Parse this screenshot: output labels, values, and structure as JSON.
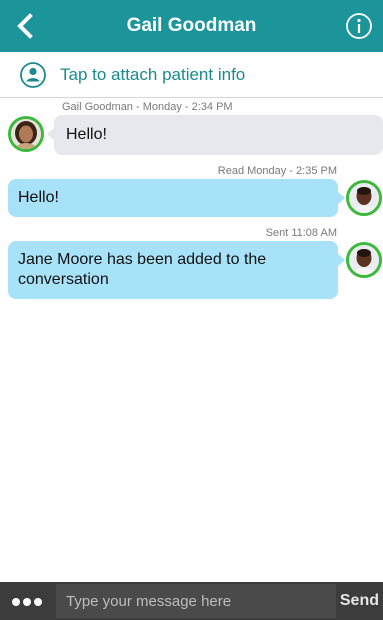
{
  "header": {
    "title": "Gail Goodman",
    "back_icon": "chevron-left-icon",
    "info_icon": "info-circle-icon",
    "color": "#1b949a"
  },
  "attach": {
    "label": "Tap to attach patient info",
    "icon": "user-circle-icon"
  },
  "messages": [
    {
      "direction": "incoming",
      "meta": "Gail Goodman - Monday - 2:34 PM",
      "text": "Hello!",
      "avatar": "female-avatar"
    },
    {
      "direction": "outgoing",
      "meta": "Read  Monday - 2:35 PM",
      "text": "Hello!",
      "avatar": "male-avatar"
    },
    {
      "direction": "outgoing",
      "meta": "Sent  11:08 AM",
      "text": "Jane Moore has been added to the conversation",
      "avatar": "male-avatar"
    }
  ],
  "composer": {
    "placeholder": "Type your message here",
    "send_label": "Send",
    "more_icon": "more-dots-icon"
  },
  "colors": {
    "incoming_bubble": "#e6e8ee",
    "outgoing_bubble": "#a8e2f8",
    "avatar_ring": "#3cb83c",
    "composer_bg": "#3c3c3c"
  }
}
